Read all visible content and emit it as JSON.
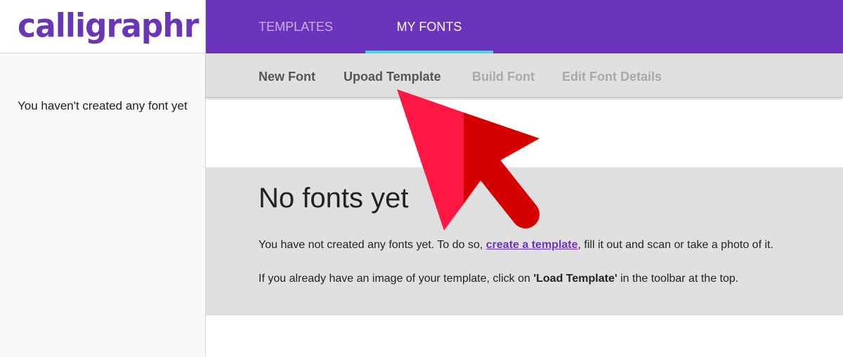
{
  "app": {
    "logo_text": "calligraphr"
  },
  "sidebar": {
    "message": "You haven't created any font yet"
  },
  "nav": {
    "tabs": [
      {
        "label": "TEMPLATES",
        "active": false
      },
      {
        "label": "MY FONTS",
        "active": true
      }
    ]
  },
  "toolbar": {
    "items": [
      {
        "label": "New Font",
        "enabled": true
      },
      {
        "label": "Upoad Template",
        "enabled": true
      },
      {
        "label": "Build Font",
        "enabled": false
      },
      {
        "label": "Edit Font Details",
        "enabled": false
      }
    ]
  },
  "empty_state": {
    "heading": "No fonts yet",
    "line1_before": "You have not created any fonts yet. To do so, ",
    "line1_link": "create a template",
    "line1_after": ", fill it out and scan or take a photo of it.",
    "line2_before": "If you already have an image of your template, click on ",
    "line2_bold": "'Load Template'",
    "line2_after": " in the toolbar at the top."
  },
  "colors": {
    "brand": "#6c33bd",
    "tab_indicator": "#4fd2e8",
    "arrow_light": "#ff1744",
    "arrow_dark": "#d50000"
  },
  "overlay": {
    "pointer_arrow": "arrow-pointer-icon"
  }
}
